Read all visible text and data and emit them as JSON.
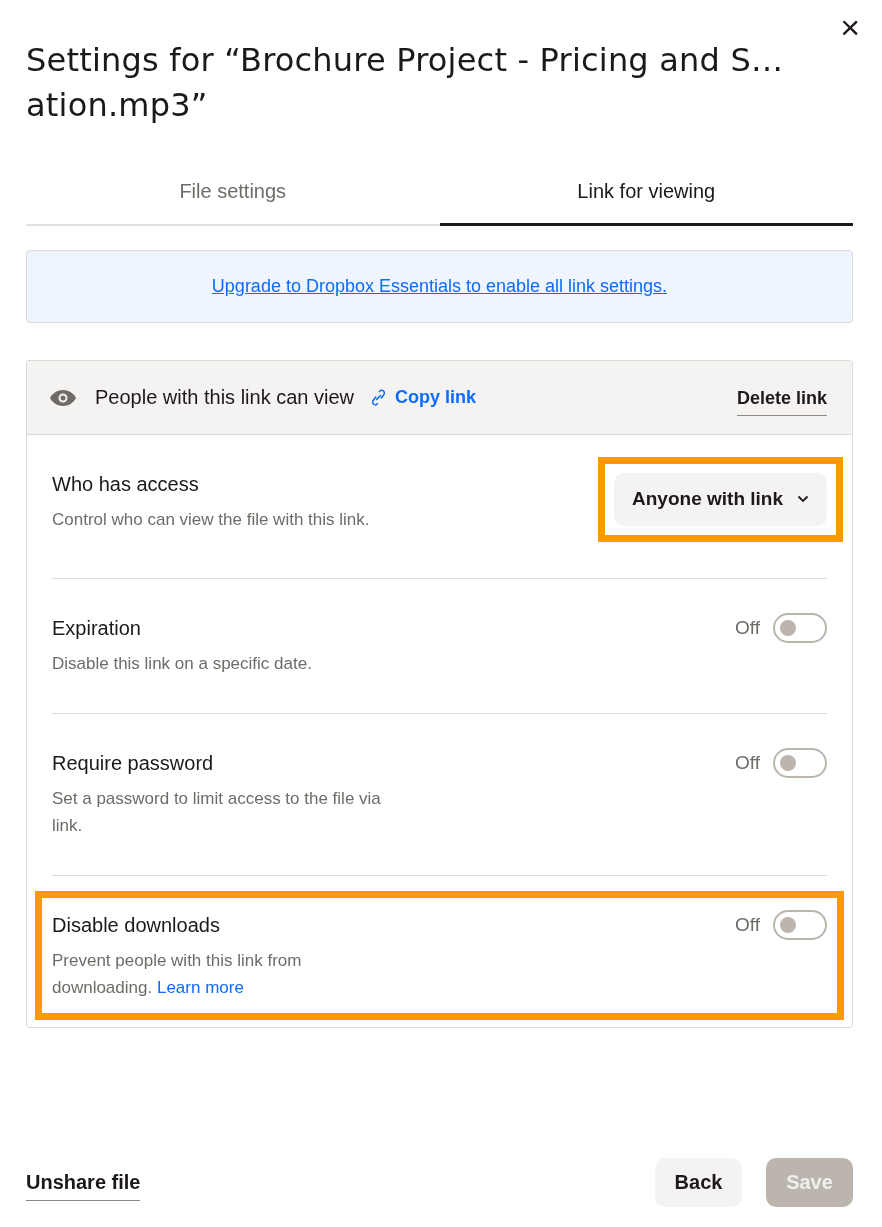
{
  "dialog": {
    "title": "Settings for “Brochure Project - Pricing and S… ation.mp3”",
    "close": "×"
  },
  "tabs": [
    {
      "label": "File settings",
      "selected": false
    },
    {
      "label": "Link for viewing",
      "selected": true
    }
  ],
  "banner": {
    "link": "Upgrade to Dropbox Essentials to enable all link settings."
  },
  "link_header": {
    "permission": "People with this link can view",
    "copy": "Copy link",
    "delete": "Delete link"
  },
  "settings": [
    {
      "kind": "dropdown",
      "title": "Who has access",
      "description": "Control who can view the file with this link.",
      "value": "Anyone with link",
      "highlighted": true
    },
    {
      "kind": "toggle",
      "title": "Expiration",
      "description": "Disable this link on a specific date.",
      "state_label": "Off",
      "on": false,
      "highlighted": false
    },
    {
      "kind": "toggle",
      "title": "Require password",
      "description": "Set a password to limit access to the file via link.",
      "state_label": "Off",
      "on": false,
      "highlighted": false
    },
    {
      "kind": "toggle",
      "title": "Disable downloads",
      "description": "Prevent people with this link from downloading.",
      "link": "Learn more",
      "state_label": "Off",
      "on": false,
      "highlighted": true
    }
  ],
  "footer": {
    "unshare": "Unshare file",
    "buttons": [
      {
        "label": "Back",
        "disabled": false
      },
      {
        "label": "Save",
        "disabled": true
      }
    ]
  }
}
